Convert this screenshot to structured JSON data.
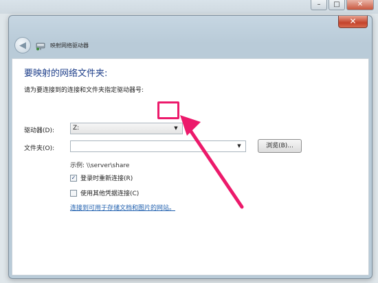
{
  "outer_window": {
    "buttons": [
      {
        "name": "minimize",
        "glyph": "–"
      },
      {
        "name": "maximize",
        "glyph": "□"
      },
      {
        "name": "close",
        "glyph": "✕"
      }
    ]
  },
  "dialog": {
    "close_glyph": "✕",
    "back_glyph": "◀",
    "nav_title": "映射网络驱动器",
    "heading": "要映射的网络文件夹:",
    "subtitle": "请为要连接到的连接和文件夹指定驱动器号:",
    "drive": {
      "label": "驱动器(D):",
      "value": "Z:",
      "arrow": "▼"
    },
    "folder": {
      "label": "文件夹(O):",
      "value": "",
      "arrow": "▼"
    },
    "browse_label": "浏览(B)...",
    "example": "示例: \\\\server\\share",
    "reconnect": {
      "label": "登录时重新连接(R)",
      "checked": true,
      "mark": "✓"
    },
    "other_credentials": {
      "label": "使用其他凭据连接(C)",
      "checked": false,
      "mark": ""
    },
    "link": "连接到可用于存储文档和图片的网站。"
  },
  "annotation": {
    "highlight_color": "#ec1a6b"
  }
}
